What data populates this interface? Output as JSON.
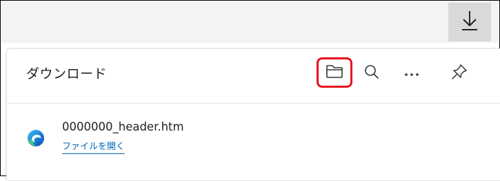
{
  "toolbar": {
    "download_icon": "download-icon"
  },
  "downloads_panel": {
    "title": "ダウンロード",
    "actions": [
      {
        "name": "open-downloads-folder",
        "icon": "folder-icon",
        "highlighted": true,
        "highlight_color": "#e8101c"
      },
      {
        "name": "search-downloads",
        "icon": "search-icon"
      },
      {
        "name": "more-options",
        "icon": "more-icon"
      },
      {
        "name": "pin-panel",
        "icon": "pin-icon"
      }
    ],
    "items": [
      {
        "icon": "edge-icon",
        "file_name": "0000000_header.htm",
        "action_label": "ファイルを開く"
      }
    ]
  },
  "colors": {
    "link": "#0067b8",
    "highlight": "#e8101c",
    "toolbar_bg": "#f3f3f3",
    "active_button_bg": "#d9d9d9"
  }
}
